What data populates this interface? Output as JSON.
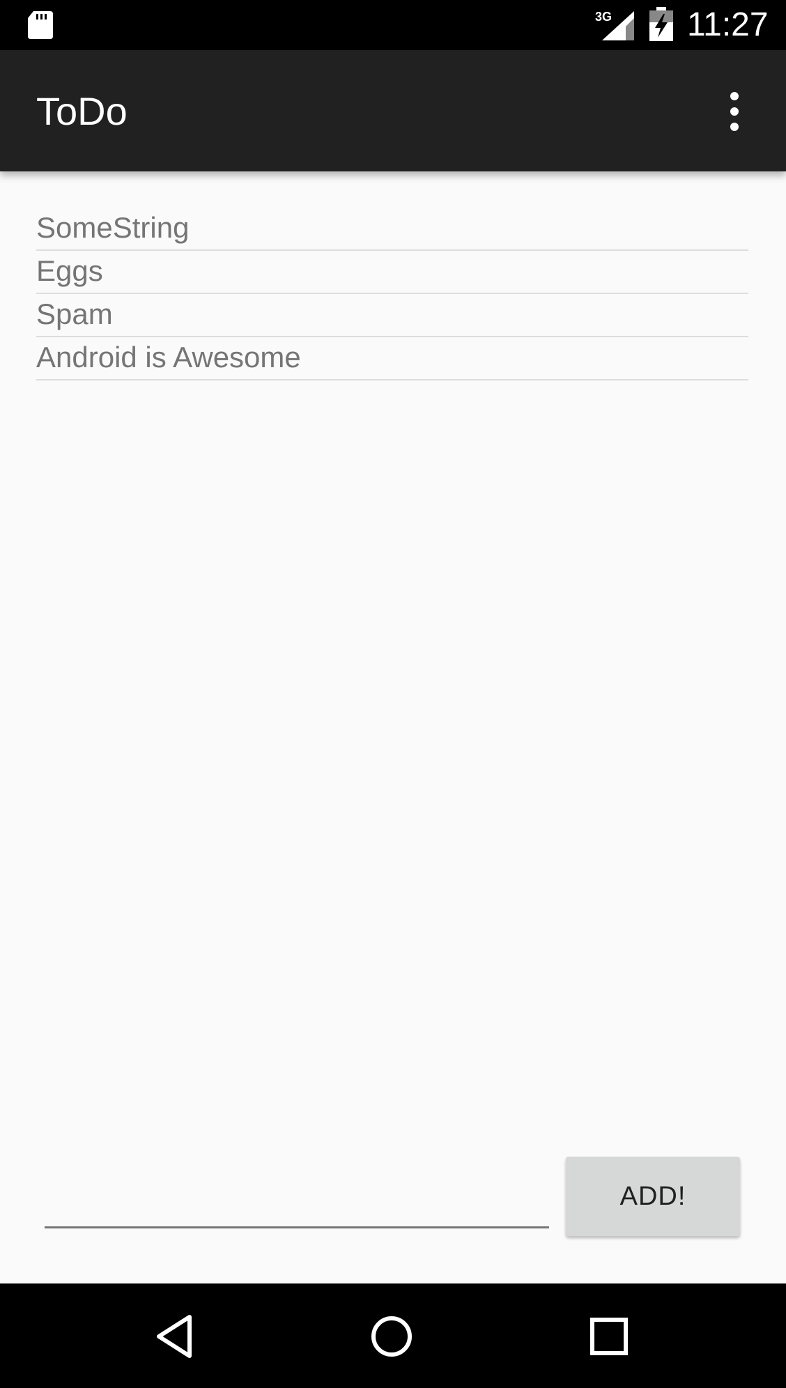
{
  "status_bar": {
    "time": "11:27",
    "network": "3G",
    "icons": [
      "sd-card-icon",
      "signal-icon",
      "battery-charging-icon"
    ]
  },
  "app_bar": {
    "title": "ToDo",
    "menu_icon": "more-vert-icon"
  },
  "todo_list": {
    "items": [
      {
        "label": "SomeString"
      },
      {
        "label": "Eggs"
      },
      {
        "label": "Spam"
      },
      {
        "label": "Android is Awesome"
      }
    ]
  },
  "input": {
    "value": "",
    "placeholder": ""
  },
  "add_button": {
    "label": "ADD!"
  },
  "nav_bar": {
    "icons": [
      "back-icon",
      "home-icon",
      "recents-icon"
    ]
  }
}
